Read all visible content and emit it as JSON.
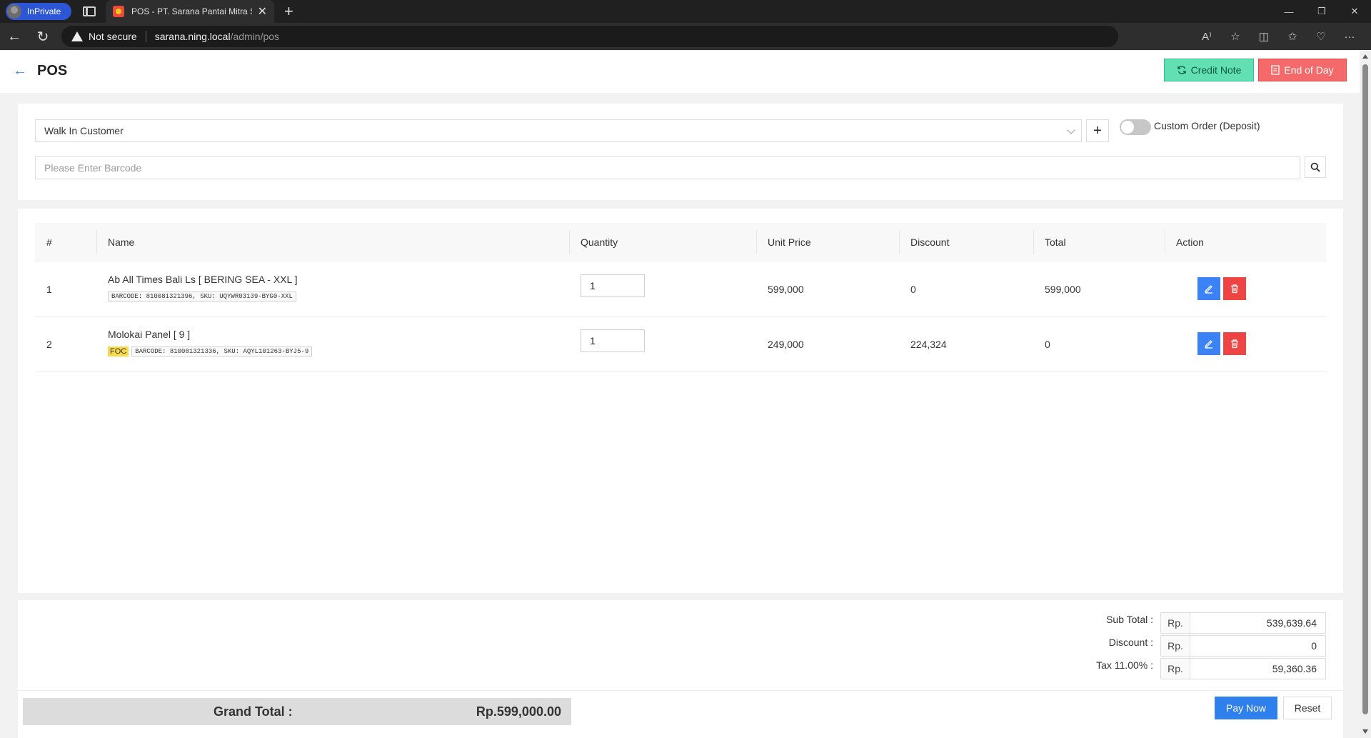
{
  "browser": {
    "inprivate_label": "InPrivate",
    "tab_title": "POS - PT. Sarana Pantai Mitra Se",
    "not_secure": "Not secure",
    "url_host": "sarana.ning.local",
    "url_path": "/admin/pos"
  },
  "header": {
    "title": "POS",
    "credit_note_label": "Credit Note",
    "end_of_day_label": "End of Day"
  },
  "customer": {
    "selected": "Walk In Customer",
    "add_label": "+",
    "custom_order_label": "Custom Order (Deposit)"
  },
  "barcode": {
    "placeholder": "Please Enter Barcode"
  },
  "table": {
    "headers": [
      "#",
      "Name",
      "Quantity",
      "Unit Price",
      "Discount",
      "Total",
      "Action"
    ],
    "rows": [
      {
        "no": "1",
        "name": "Ab All Times Bali Ls [ BERING SEA - XXL ]",
        "foc": "",
        "codes": "BARCODE: 810081321396, SKU: UQYWR03139-BYG0-XXL",
        "quantity": "1",
        "unit_price": "599,000",
        "discount": "0",
        "total": "599,000"
      },
      {
        "no": "2",
        "name": "Molokai Panel [ 9 ]",
        "foc": "FOC",
        "codes": "BARCODE: 810081321336, SKU: AQYL101263-BYJ5-9",
        "quantity": "1",
        "unit_price": "249,000",
        "discount": "224,324",
        "total": "0"
      }
    ]
  },
  "summary": {
    "currency": "Rp.",
    "subtotal_label": "Sub Total :",
    "subtotal": "539,639.64",
    "discount_label": "Discount :",
    "discount": "0",
    "tax_label": "Tax 11.00% :",
    "tax": "59,360.36",
    "grand_total_label": "Grand Total :",
    "grand_total": "Rp.599,000.00",
    "pay_label": "Pay Now",
    "reset_label": "Reset"
  },
  "colors": {
    "credit_note": "#63e0b3",
    "end_of_day": "#f46a6a",
    "primary": "#2f80ed",
    "foc_badge": "#f7d94c"
  }
}
